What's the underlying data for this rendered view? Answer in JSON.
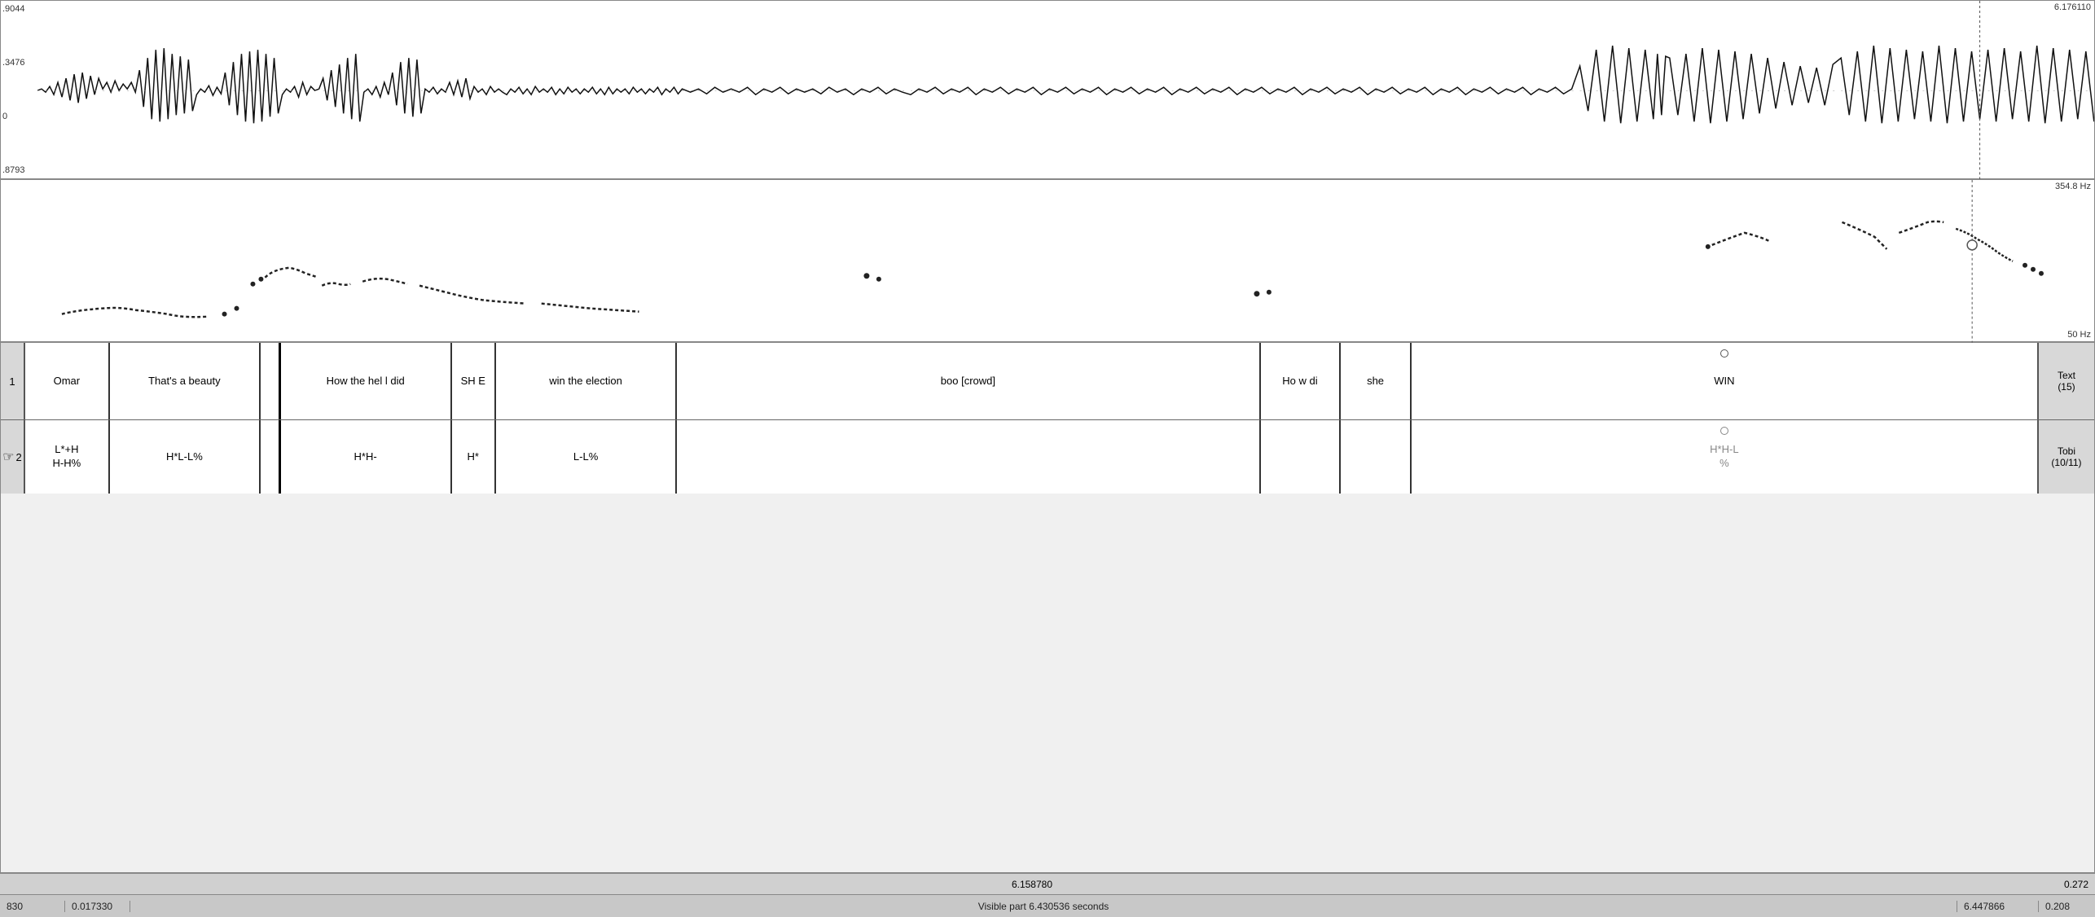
{
  "waveform": {
    "y_labels": [
      ".9044",
      ".3476",
      "0",
      ".8793"
    ],
    "top_right_time": "6.176110"
  },
  "pitch": {
    "y_label_top": "354.8 Hz",
    "y_label_bottom": "50 Hz"
  },
  "tier1": {
    "number": "1",
    "cells": [
      {
        "text": "Omar",
        "width_pct": 4.2
      },
      {
        "text": "That's a beauty",
        "width_pct": 7.5
      },
      {
        "text": "",
        "width_pct": 1.0
      },
      {
        "text": "How the hel l did",
        "width_pct": 8.5
      },
      {
        "text": "SH E",
        "width_pct": 2.2
      },
      {
        "text": "win the election",
        "width_pct": 9.0
      },
      {
        "text": "boo [crowd]",
        "width_pct": 29.0
      },
      {
        "text": "Ho w di",
        "width_pct": 4.0
      },
      {
        "text": "she",
        "width_pct": 3.5
      },
      {
        "text": "WIN",
        "width_pct": 5.5
      }
    ],
    "right_label": "Text\n(15)"
  },
  "tier2": {
    "number": "2",
    "icon": "☞",
    "cells": [
      {
        "text": "L*+H\nH-H%",
        "width_pct": 4.2
      },
      {
        "text": "H*L-L%",
        "width_pct": 7.5
      },
      {
        "text": "",
        "width_pct": 1.0
      },
      {
        "text": "H*H-",
        "width_pct": 8.5
      },
      {
        "text": "H*",
        "width_pct": 2.2
      },
      {
        "text": "L-L%",
        "width_pct": 9.0
      },
      {
        "text": "",
        "width_pct": 29.0
      },
      {
        "text": "",
        "width_pct": 4.0
      },
      {
        "text": "",
        "width_pct": 3.5
      },
      {
        "text": "H*H-L\n%",
        "width_pct": 5.5
      }
    ],
    "right_label": "Tobi\n(10/11)"
  },
  "status_bar": {
    "left": "830",
    "left2": "0.017330",
    "center": "Visible part 6.430536 seconds",
    "right": "6.447866",
    "dur": "0.208",
    "center2": "6.158780",
    "dur2": "0.272"
  }
}
